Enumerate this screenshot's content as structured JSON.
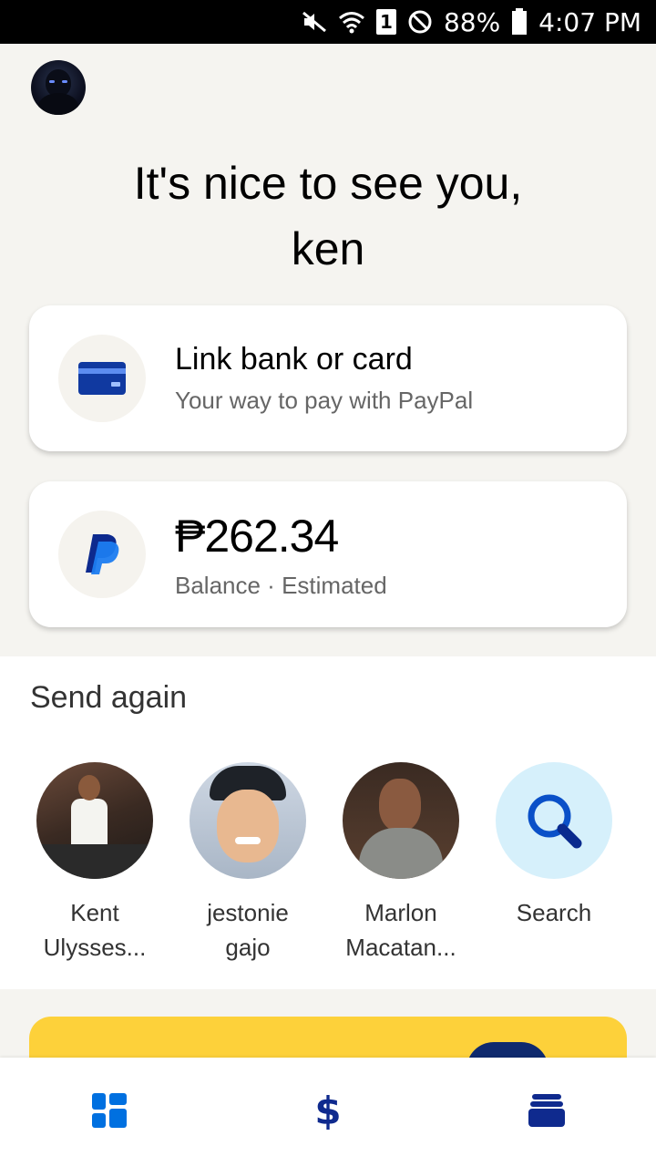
{
  "status_bar": {
    "battery": "88%",
    "time": "4:07 PM",
    "sim": "1"
  },
  "greeting": {
    "line1": "It's nice to see you,",
    "line2": "ken"
  },
  "link_card": {
    "title": "Link bank or card",
    "subtitle": "Your way to pay with PayPal",
    "icon": "credit-card-icon"
  },
  "balance_card": {
    "amount": "₱262.34",
    "label": "Balance · Estimated",
    "icon": "paypal-logo-icon"
  },
  "send_again": {
    "title": "Send again",
    "contacts": [
      {
        "line1": "Kent",
        "line2": "Ulysses..."
      },
      {
        "line1": "jestonie",
        "line2": "gajo"
      },
      {
        "line1": "Marlon",
        "line2": "Macatan..."
      },
      {
        "line1": "Search",
        "line2": ""
      }
    ]
  },
  "bottom_nav": {
    "items": [
      "home-icon",
      "dollar-icon",
      "wallet-icon"
    ],
    "dollar_symbol": "$"
  },
  "colors": {
    "accent": "#0070e0",
    "nav_dark": "#0f2a8e",
    "promo": "#fdd13a",
    "background": "#f5f4f0"
  }
}
